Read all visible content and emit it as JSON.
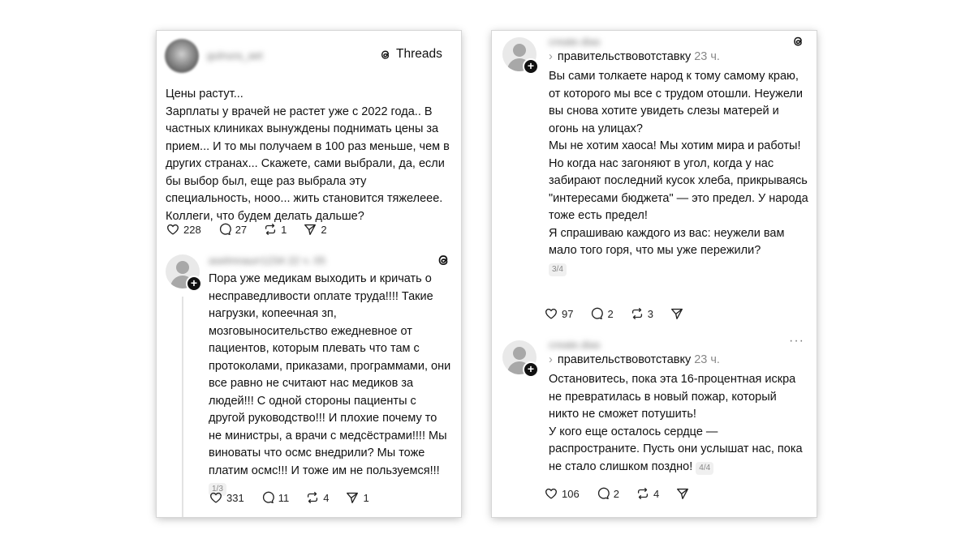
{
  "left": {
    "header": {
      "author": "gulnura_aet",
      "brand": "Threads"
    },
    "post1": {
      "paragraphs": [
        "Цены растут...",
        "Зарплаты у врачей не растет уже с 2022 года.. В частных клиниках вынуждены поднимать цены за прием... И то мы получаем в 100 раз меньше, чем в других странах... Скажете, сами выбрали, да, если бы выбор был, еще раз выбрала эту специальность, нооо... жить становится тяжелеее. Коллеги, что будем делать дальше?"
      ],
      "likes": "228",
      "comments": "27",
      "reposts": "1",
      "shares": "2"
    },
    "post2": {
      "author": "aselmnaurr1234",
      "time": "22 ч. 05",
      "text": "Пора уже медикам выходить и кричать о несправедливости оплате труда!!!! Такие нагрузки, копеечная зп, мозговыносительство ежедневное от пациентов, которым плевать что там с протоколами, приказами, программами, они все равно не считают нас медиков за людей!!! С одной стороны пациенты с другой руководство!!! И плохие почему то не министры, а врачи с медсёстрами!!!! Мы виноваты что осмс внедрили? Мы тоже платим осмс!!! И тоже им не пользуемся!!!",
      "pager": "1/3",
      "likes": "331",
      "comments": "11",
      "reposts": "4",
      "shares": "1"
    }
  },
  "right": {
    "post1": {
      "author": "create.dias",
      "reply_to": "правительствовотставку",
      "time": "23 ч.",
      "paragraphs": [
        "Вы сами толкаете народ к тому самому краю, от которого мы все с трудом отошли. Неужели вы снова хотите увидеть слезы матерей и огонь на улицах?",
        "Мы не хотим хаоса! Мы хотим мира и работы! Но когда нас загоняют в угол, когда у нас забирают последний кусок хлеба, прикрываясь \"интересами бюджета\" — это предел. У народа тоже есть предел!",
        "Я спрашиваю каждого из вас: неужели вам мало того горя, что мы уже пережили?"
      ],
      "pager": "3/4",
      "likes": "97",
      "comments": "2",
      "reposts": "3"
    },
    "post2": {
      "author": "create.dias",
      "reply_to": "правительствовотставку",
      "time": "23 ч.",
      "more": "···",
      "paragraphs": [
        "Остановитесь, пока эта 16-процентная искра не превратилась в новый пожар, который никто не сможет потушить!",
        "У кого еще осталось сердце — распространите. Пусть они услышат нас, пока не стало слишком поздно!"
      ],
      "pager": "4/4",
      "likes": "106",
      "comments": "2",
      "reposts": "4"
    }
  }
}
